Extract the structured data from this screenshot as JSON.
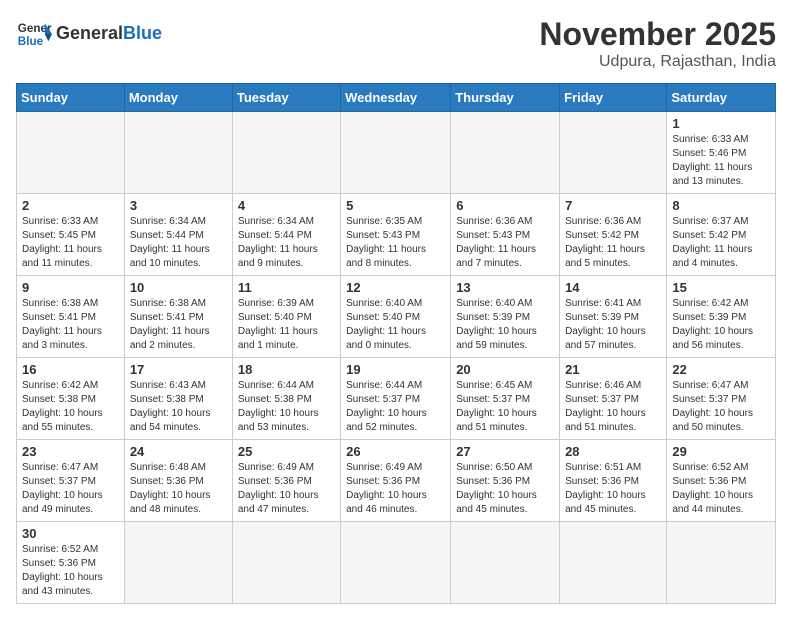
{
  "header": {
    "logo_general": "General",
    "logo_blue": "Blue",
    "month_title": "November 2025",
    "location": "Udpura, Rajasthan, India"
  },
  "days_of_week": [
    "Sunday",
    "Monday",
    "Tuesday",
    "Wednesday",
    "Thursday",
    "Friday",
    "Saturday"
  ],
  "weeks": [
    [
      {
        "day": "",
        "info": ""
      },
      {
        "day": "",
        "info": ""
      },
      {
        "day": "",
        "info": ""
      },
      {
        "day": "",
        "info": ""
      },
      {
        "day": "",
        "info": ""
      },
      {
        "day": "",
        "info": ""
      },
      {
        "day": "1",
        "info": "Sunrise: 6:33 AM\nSunset: 5:46 PM\nDaylight: 11 hours and 13 minutes."
      }
    ],
    [
      {
        "day": "2",
        "info": "Sunrise: 6:33 AM\nSunset: 5:45 PM\nDaylight: 11 hours and 11 minutes."
      },
      {
        "day": "3",
        "info": "Sunrise: 6:34 AM\nSunset: 5:44 PM\nDaylight: 11 hours and 10 minutes."
      },
      {
        "day": "4",
        "info": "Sunrise: 6:34 AM\nSunset: 5:44 PM\nDaylight: 11 hours and 9 minutes."
      },
      {
        "day": "5",
        "info": "Sunrise: 6:35 AM\nSunset: 5:43 PM\nDaylight: 11 hours and 8 minutes."
      },
      {
        "day": "6",
        "info": "Sunrise: 6:36 AM\nSunset: 5:43 PM\nDaylight: 11 hours and 7 minutes."
      },
      {
        "day": "7",
        "info": "Sunrise: 6:36 AM\nSunset: 5:42 PM\nDaylight: 11 hours and 5 minutes."
      },
      {
        "day": "8",
        "info": "Sunrise: 6:37 AM\nSunset: 5:42 PM\nDaylight: 11 hours and 4 minutes."
      }
    ],
    [
      {
        "day": "9",
        "info": "Sunrise: 6:38 AM\nSunset: 5:41 PM\nDaylight: 11 hours and 3 minutes."
      },
      {
        "day": "10",
        "info": "Sunrise: 6:38 AM\nSunset: 5:41 PM\nDaylight: 11 hours and 2 minutes."
      },
      {
        "day": "11",
        "info": "Sunrise: 6:39 AM\nSunset: 5:40 PM\nDaylight: 11 hours and 1 minute."
      },
      {
        "day": "12",
        "info": "Sunrise: 6:40 AM\nSunset: 5:40 PM\nDaylight: 11 hours and 0 minutes."
      },
      {
        "day": "13",
        "info": "Sunrise: 6:40 AM\nSunset: 5:39 PM\nDaylight: 10 hours and 59 minutes."
      },
      {
        "day": "14",
        "info": "Sunrise: 6:41 AM\nSunset: 5:39 PM\nDaylight: 10 hours and 57 minutes."
      },
      {
        "day": "15",
        "info": "Sunrise: 6:42 AM\nSunset: 5:39 PM\nDaylight: 10 hours and 56 minutes."
      }
    ],
    [
      {
        "day": "16",
        "info": "Sunrise: 6:42 AM\nSunset: 5:38 PM\nDaylight: 10 hours and 55 minutes."
      },
      {
        "day": "17",
        "info": "Sunrise: 6:43 AM\nSunset: 5:38 PM\nDaylight: 10 hours and 54 minutes."
      },
      {
        "day": "18",
        "info": "Sunrise: 6:44 AM\nSunset: 5:38 PM\nDaylight: 10 hours and 53 minutes."
      },
      {
        "day": "19",
        "info": "Sunrise: 6:44 AM\nSunset: 5:37 PM\nDaylight: 10 hours and 52 minutes."
      },
      {
        "day": "20",
        "info": "Sunrise: 6:45 AM\nSunset: 5:37 PM\nDaylight: 10 hours and 51 minutes."
      },
      {
        "day": "21",
        "info": "Sunrise: 6:46 AM\nSunset: 5:37 PM\nDaylight: 10 hours and 51 minutes."
      },
      {
        "day": "22",
        "info": "Sunrise: 6:47 AM\nSunset: 5:37 PM\nDaylight: 10 hours and 50 minutes."
      }
    ],
    [
      {
        "day": "23",
        "info": "Sunrise: 6:47 AM\nSunset: 5:37 PM\nDaylight: 10 hours and 49 minutes."
      },
      {
        "day": "24",
        "info": "Sunrise: 6:48 AM\nSunset: 5:36 PM\nDaylight: 10 hours and 48 minutes."
      },
      {
        "day": "25",
        "info": "Sunrise: 6:49 AM\nSunset: 5:36 PM\nDaylight: 10 hours and 47 minutes."
      },
      {
        "day": "26",
        "info": "Sunrise: 6:49 AM\nSunset: 5:36 PM\nDaylight: 10 hours and 46 minutes."
      },
      {
        "day": "27",
        "info": "Sunrise: 6:50 AM\nSunset: 5:36 PM\nDaylight: 10 hours and 45 minutes."
      },
      {
        "day": "28",
        "info": "Sunrise: 6:51 AM\nSunset: 5:36 PM\nDaylight: 10 hours and 45 minutes."
      },
      {
        "day": "29",
        "info": "Sunrise: 6:52 AM\nSunset: 5:36 PM\nDaylight: 10 hours and 44 minutes."
      }
    ],
    [
      {
        "day": "30",
        "info": "Sunrise: 6:52 AM\nSunset: 5:36 PM\nDaylight: 10 hours and 43 minutes."
      },
      {
        "day": "",
        "info": ""
      },
      {
        "day": "",
        "info": ""
      },
      {
        "day": "",
        "info": ""
      },
      {
        "day": "",
        "info": ""
      },
      {
        "day": "",
        "info": ""
      },
      {
        "day": "",
        "info": ""
      }
    ]
  ]
}
